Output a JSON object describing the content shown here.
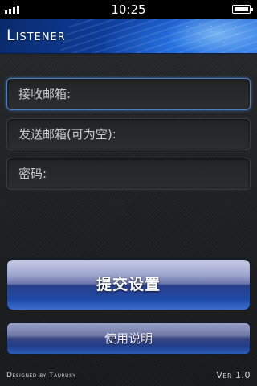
{
  "status_bar": {
    "time": "10:25",
    "signal_icon": "signal-strength-icon",
    "battery_icon": "battery-full-icon"
  },
  "header": {
    "title": "Listener"
  },
  "form": {
    "receive_email_placeholder": "接收邮箱:",
    "send_email_placeholder": "发送邮箱(可为空):",
    "password_placeholder": "密码:"
  },
  "buttons": {
    "submit_label": "提交设置",
    "help_label": "使用说明"
  },
  "footer": {
    "credit": "Designed by Taurusy",
    "version": "Ver 1.0"
  },
  "colors": {
    "header_blue": "#1a5ccf",
    "focus_border": "#4a7fc4",
    "background": "#1e1f21"
  }
}
